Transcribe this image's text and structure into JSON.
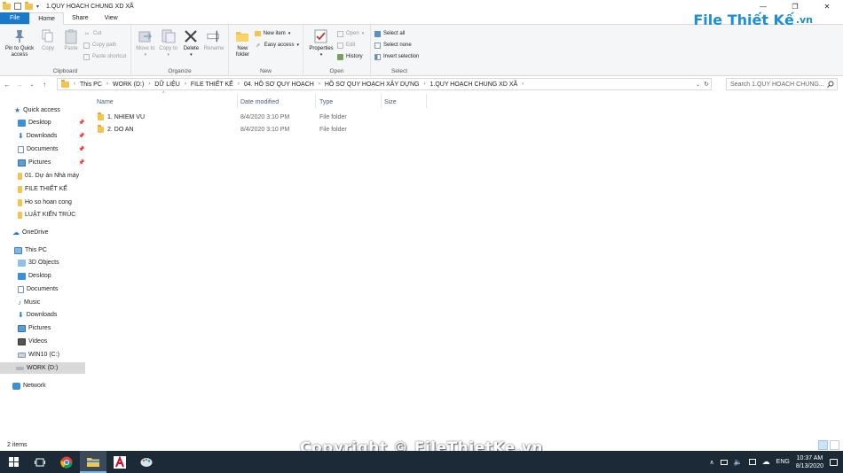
{
  "window": {
    "title": "1.QUY HOACH CHUNG XD XÃ",
    "controls": {
      "minimize": "—",
      "maximize": "❐",
      "close": "✕"
    }
  },
  "tabs": [
    {
      "label": "File"
    },
    {
      "label": "Home"
    },
    {
      "label": "Share"
    },
    {
      "label": "View"
    }
  ],
  "ribbon": {
    "clipboard": {
      "label": "Clipboard",
      "pin": "Pin to Quick access",
      "copy": "Copy",
      "paste": "Paste",
      "cut": "Cut",
      "copy_path": "Copy path",
      "paste_shortcut": "Paste shortcut"
    },
    "organize": {
      "label": "Organize",
      "move_to": "Move to",
      "copy_to": "Copy to",
      "delete": "Delete",
      "rename": "Rename"
    },
    "new": {
      "label": "New",
      "new_folder": "New folder",
      "new_item": "New item",
      "easy_access": "Easy access"
    },
    "open": {
      "label": "Open",
      "properties": "Properties",
      "open": "Open",
      "edit": "Edit",
      "history": "History"
    },
    "select": {
      "label": "Select",
      "select_all": "Select all",
      "select_none": "Select none",
      "invert": "Invert selection"
    }
  },
  "logo": {
    "text": "File Thiết Kế",
    "suffix": ".vn"
  },
  "address": {
    "crumbs": [
      "This PC",
      "WORK (D:)",
      "DỮ LIỆU",
      "FILE THIẾT KẾ",
      "04. HỒ SƠ QUY HOẠCH",
      "HỒ SƠ QUY HOẠCH XÂY DỰNG",
      "1.QUY HOẠCH CHUNG XD XÃ"
    ],
    "search_placeholder": "Search 1.QUY HOẠCH CHUNG..."
  },
  "nav": {
    "quick_access": "Quick access",
    "quick_items": [
      "Desktop",
      "Downloads",
      "Documents",
      "Pictures",
      "01. Dự án Nhà máy",
      "FILE THIẾT KẾ",
      "Ho so hoan cong",
      "LUẬT KIẾN TRÚC"
    ],
    "onedrive": "OneDrive",
    "this_pc": "This PC",
    "pc_items": [
      "3D Objects",
      "Desktop",
      "Documents",
      "Music",
      "Downloads",
      "Pictures",
      "Videos",
      "WIN10 (C:)",
      "WORK (D:)"
    ],
    "network": "Network"
  },
  "columns": {
    "name": "Name",
    "date": "Date modified",
    "type": "Type",
    "size": "Size"
  },
  "files": [
    {
      "name": "1. NHIEM VU",
      "date": "8/4/2020 3:10 PM",
      "type": "File folder"
    },
    {
      "name": "2. DO AN",
      "date": "8/4/2020 3:10 PM",
      "type": "File folder"
    }
  ],
  "status": {
    "count": "2 items"
  },
  "copyright": "Copyright © FileThietKe.vn",
  "taskbar": {
    "lang": "ENG",
    "time": "10:37 AM",
    "date": "8/13/2020"
  }
}
